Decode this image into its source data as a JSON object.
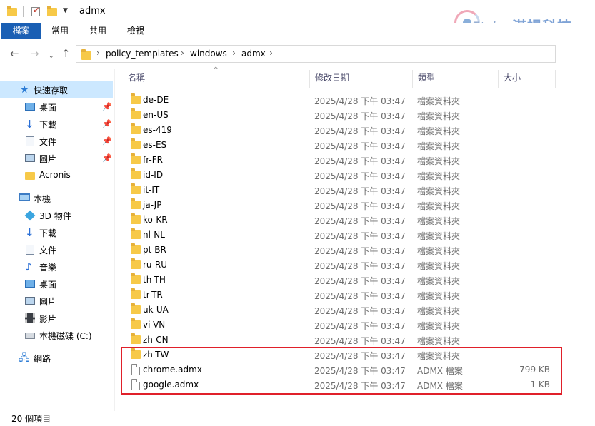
{
  "window": {
    "title": "admx"
  },
  "ribbon": {
    "tabs": [
      "檔案",
      "常用",
      "共用",
      "檢視"
    ]
  },
  "logo": {
    "brand_latin": "T-tech",
    "brand_cn": "湛揚科技"
  },
  "address": {
    "crumbs": [
      "policy_templates",
      "windows",
      "admx"
    ]
  },
  "sidebar": {
    "quick_access": {
      "label": "快速存取",
      "items": [
        {
          "label": "桌面",
          "icon": "desktop-icon",
          "pinned": true
        },
        {
          "label": "下載",
          "icon": "download-icon",
          "pinned": true
        },
        {
          "label": "文件",
          "icon": "document-icon",
          "pinned": true
        },
        {
          "label": "圖片",
          "icon": "picture-icon",
          "pinned": true
        },
        {
          "label": "Acronis",
          "icon": "folder-icon",
          "pinned": false
        }
      ]
    },
    "this_pc": {
      "label": "本機",
      "items": [
        {
          "label": "3D 物件",
          "icon": "3d-objects-icon"
        },
        {
          "label": "下載",
          "icon": "download-icon"
        },
        {
          "label": "文件",
          "icon": "document-icon"
        },
        {
          "label": "音樂",
          "icon": "music-icon"
        },
        {
          "label": "桌面",
          "icon": "desktop-icon"
        },
        {
          "label": "圖片",
          "icon": "picture-icon"
        },
        {
          "label": "影片",
          "icon": "video-icon"
        },
        {
          "label": "本機磁碟 (C:)",
          "icon": "drive-icon"
        }
      ]
    },
    "network": {
      "label": "網路"
    }
  },
  "columns": {
    "name": "名稱",
    "date": "修改日期",
    "type": "類型",
    "size": "大小"
  },
  "files": [
    {
      "name": "de-DE",
      "date": "2025/4/28 下午 03:47",
      "type": "檔案資料夾",
      "size": "",
      "kind": "folder"
    },
    {
      "name": "en-US",
      "date": "2025/4/28 下午 03:47",
      "type": "檔案資料夾",
      "size": "",
      "kind": "folder"
    },
    {
      "name": "es-419",
      "date": "2025/4/28 下午 03:47",
      "type": "檔案資料夾",
      "size": "",
      "kind": "folder"
    },
    {
      "name": "es-ES",
      "date": "2025/4/28 下午 03:47",
      "type": "檔案資料夾",
      "size": "",
      "kind": "folder"
    },
    {
      "name": "fr-FR",
      "date": "2025/4/28 下午 03:47",
      "type": "檔案資料夾",
      "size": "",
      "kind": "folder"
    },
    {
      "name": "id-ID",
      "date": "2025/4/28 下午 03:47",
      "type": "檔案資料夾",
      "size": "",
      "kind": "folder"
    },
    {
      "name": "it-IT",
      "date": "2025/4/28 下午 03:47",
      "type": "檔案資料夾",
      "size": "",
      "kind": "folder"
    },
    {
      "name": "ja-JP",
      "date": "2025/4/28 下午 03:47",
      "type": "檔案資料夾",
      "size": "",
      "kind": "folder"
    },
    {
      "name": "ko-KR",
      "date": "2025/4/28 下午 03:47",
      "type": "檔案資料夾",
      "size": "",
      "kind": "folder"
    },
    {
      "name": "nl-NL",
      "date": "2025/4/28 下午 03:47",
      "type": "檔案資料夾",
      "size": "",
      "kind": "folder"
    },
    {
      "name": "pt-BR",
      "date": "2025/4/28 下午 03:47",
      "type": "檔案資料夾",
      "size": "",
      "kind": "folder"
    },
    {
      "name": "ru-RU",
      "date": "2025/4/28 下午 03:47",
      "type": "檔案資料夾",
      "size": "",
      "kind": "folder"
    },
    {
      "name": "th-TH",
      "date": "2025/4/28 下午 03:47",
      "type": "檔案資料夾",
      "size": "",
      "kind": "folder"
    },
    {
      "name": "tr-TR",
      "date": "2025/4/28 下午 03:47",
      "type": "檔案資料夾",
      "size": "",
      "kind": "folder"
    },
    {
      "name": "uk-UA",
      "date": "2025/4/28 下午 03:47",
      "type": "檔案資料夾",
      "size": "",
      "kind": "folder"
    },
    {
      "name": "vi-VN",
      "date": "2025/4/28 下午 03:47",
      "type": "檔案資料夾",
      "size": "",
      "kind": "folder"
    },
    {
      "name": "zh-CN",
      "date": "2025/4/28 下午 03:47",
      "type": "檔案資料夾",
      "size": "",
      "kind": "folder"
    },
    {
      "name": "zh-TW",
      "date": "2025/4/28 下午 03:47",
      "type": "檔案資料夾",
      "size": "",
      "kind": "folder"
    },
    {
      "name": "chrome.admx",
      "date": "2025/4/28 下午 03:47",
      "type": "ADMX 檔案",
      "size": "799 KB",
      "kind": "file"
    },
    {
      "name": "google.admx",
      "date": "2025/4/28 下午 03:47",
      "type": "ADMX 檔案",
      "size": "1 KB",
      "kind": "file"
    }
  ],
  "status": {
    "count": "20 個項目"
  },
  "colors": {
    "ribbon_file_tab": "#1a5fb4",
    "selection": "#cce8ff",
    "highlight_box": "#e0202a",
    "folder": "#f7c948"
  }
}
